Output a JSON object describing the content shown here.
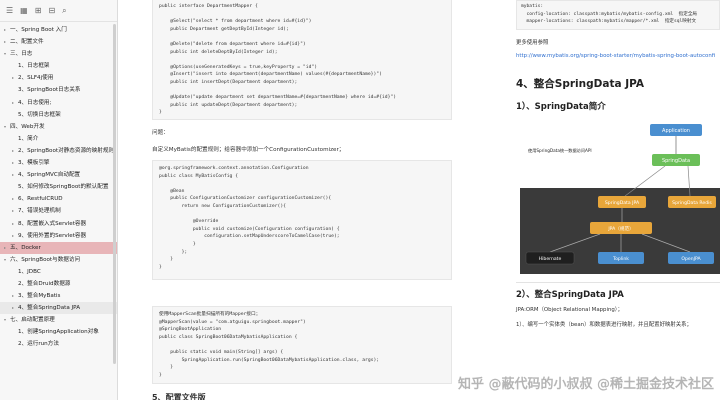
{
  "sidebar": {
    "toolbar_icons": [
      "list-icon",
      "grid-icon",
      "expand-icon",
      "collapse-icon",
      "search-icon"
    ],
    "items": [
      {
        "label": "一、Spring Boot 入门",
        "level": 0,
        "arrow": "▸"
      },
      {
        "label": "二、配置文件",
        "level": 0,
        "arrow": "▸"
      },
      {
        "label": "三、日志",
        "level": 0,
        "arrow": "▾"
      },
      {
        "label": "1、日志框架",
        "level": 1,
        "arrow": ""
      },
      {
        "label": "2、SLF4j使用",
        "level": 1,
        "arrow": "▸"
      },
      {
        "label": "3、SpringBoot日志关系",
        "level": 1,
        "arrow": ""
      },
      {
        "label": "4、日志使用;",
        "level": 1,
        "arrow": "▸"
      },
      {
        "label": "5、切换日志框架",
        "level": 1,
        "arrow": ""
      },
      {
        "label": "四、Web开发",
        "level": 0,
        "arrow": "▾"
      },
      {
        "label": "1、简介",
        "level": 1,
        "arrow": ""
      },
      {
        "label": "2、SpringBoot对静态资源的映射规则;",
        "level": 1,
        "arrow": "▸"
      },
      {
        "label": "3、模板引擎",
        "level": 1,
        "arrow": "▸"
      },
      {
        "label": "4、SpringMVC自动配置",
        "level": 1,
        "arrow": "▸"
      },
      {
        "label": "5、如何修改SpringBoot的默认配置",
        "level": 1,
        "arrow": ""
      },
      {
        "label": "6、RestfulCRUD",
        "level": 1,
        "arrow": "▸"
      },
      {
        "label": "7、错误处理机制",
        "level": 1,
        "arrow": "▸"
      },
      {
        "label": "8、配置嵌入式Servlet容器",
        "level": 1,
        "arrow": "▸"
      },
      {
        "label": "9、使用外置的Servlet容器",
        "level": 1,
        "arrow": "▸"
      },
      {
        "label": "五、Docker",
        "level": 0,
        "arrow": "▸",
        "active": true
      },
      {
        "label": "六、SpringBoot与数据访问",
        "level": 0,
        "arrow": "▾"
      },
      {
        "label": "1、JDBC",
        "level": 1,
        "arrow": ""
      },
      {
        "label": "2、整合Druid数据源",
        "level": 1,
        "arrow": ""
      },
      {
        "label": "3、整合MyBatis",
        "level": 1,
        "arrow": "▸"
      },
      {
        "label": "4、整合SpringData JPA",
        "level": 1,
        "arrow": "▸",
        "current": true
      },
      {
        "label": "七、启动配置原理",
        "level": 0,
        "arrow": "▾"
      },
      {
        "label": "1、创建SpringApplication对象",
        "level": 1,
        "arrow": ""
      },
      {
        "label": "2、运行run方法",
        "level": 1,
        "arrow": ""
      }
    ]
  },
  "middle": {
    "code1": [
      "public interface DepartmentMapper {",
      "",
      "    @Select(\"select * from department where id=#{id}\")",
      "    public Department getDeptById(Integer id);",
      "",
      "    @Delete(\"delete from department where id=#{id}\")",
      "    public int deleteDeptById(Integer id);",
      "",
      "    @Options(useGeneratedKeys = true,keyProperty = \"id\")",
      "    @Insert(\"insert into department(departmentName) values(#{departmentName})\")",
      "    public int insertDept(Department department);",
      "",
      "    @Update(\"update department set departmentName=#{departmentName} where id=#{id}\")",
      "    public int updateDept(Department department);",
      "}"
    ],
    "question": "问题：",
    "question_desc": "自定义MyBatis的配置规则；给容器中添加一个ConfigurationCustomizer；",
    "code2": [
      "@org.springframework.context.annotation.Configuration",
      "public class MyBatisConfig {",
      "",
      "    @Bean",
      "    public ConfigurationCustomizer configurationCustomizer(){",
      "        return new ConfigurationCustomizer(){",
      "",
      "            @Override",
      "            public void customize(Configuration configuration) {",
      "                configuration.setMapUnderscoreToCamelCase(true);",
      "            }",
      "        };",
      "    }",
      "}"
    ],
    "code3": [
      "使用MapperScan批量扫描所有的Mapper接口；",
      "@MapperScan(value = \"com.atguigu.springboot.mapper\")",
      "@SpringBootApplication",
      "public class SpringBoot06DataMybatisApplication {",
      "",
      "    public static void main(String[] args) {",
      "        SpringApplication.run(SpringBoot06DataMybatisApplication.class, args);",
      "    }",
      "}"
    ],
    "bottom_heading": "5、配置文件版"
  },
  "right": {
    "yaml": [
      "mybatis:",
      "  config-location: classpath:mybatis/mybatis-config.xml  指定全局",
      "  mapper-locations: classpath:mybatis/mapper/*.xml  指定sql映射文"
    ],
    "more_usage": "更多使用参照",
    "link": "http://www.mybatis.org/spring-boot-starter/mybatis-spring-boot-autoconfi",
    "section4": "4、整合SpringData JPA",
    "sub1": "1）、SpringData简介",
    "sub2": "2）、整合SpringData JPA",
    "jpa_desc": "JPA:ORM（Object Relational Mapping）；",
    "step1": "1）、编写一个实体类（bean）和数据表进行映射，并且配置好映射关系；",
    "diagram": {
      "application": "Application",
      "caption": "使用SpringData统一数据访问API",
      "springdata": "SpringData",
      "jpa_box": "SpringData JPA",
      "redis_box": "SpringData Redis",
      "jpa_spec": "JPA（规范）",
      "hibernate": "Hibernate",
      "toplink": "Toplink",
      "openjpa": "OpenJPA",
      "colors": {
        "blue": "#4a8fd0",
        "green": "#6bbf59",
        "orange": "#e8a63a",
        "dark": "#2f2f2f"
      }
    }
  },
  "watermark": "知乎 @蔽代码的小叔叔  @稀土掘金技术社区"
}
